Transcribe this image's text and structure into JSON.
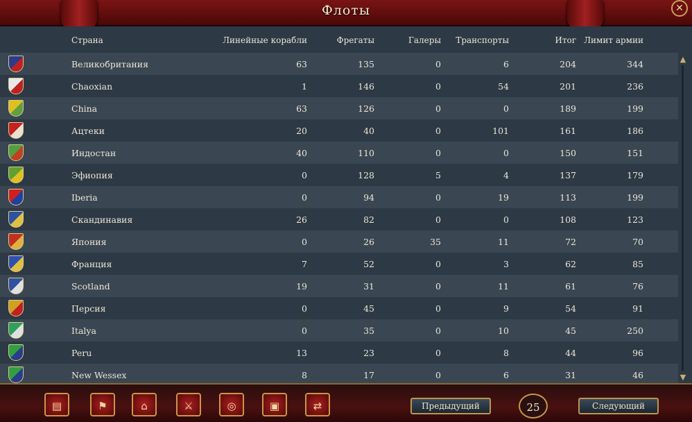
{
  "window": {
    "title": "Флоты",
    "close_icon": "close-icon"
  },
  "columns": {
    "country": "Страна",
    "ships_of_line": "Линейные корабли",
    "frigates": "Фрегаты",
    "galleys": "Галеры",
    "transports": "Транспорты",
    "total": "Итог",
    "limit": "Лимит армии"
  },
  "rows": [
    {
      "name": "Великобритания",
      "a": "63",
      "b": "135",
      "c": "0",
      "d": "6",
      "t": "204",
      "l": "344",
      "flag": "#2a3c8a",
      "flag2": "#c02020"
    },
    {
      "name": "Chaoxian",
      "a": "1",
      "b": "146",
      "c": "0",
      "d": "54",
      "t": "201",
      "l": "236",
      "flag": "#e8e8e8",
      "flag2": "#c02020"
    },
    {
      "name": "China",
      "a": "63",
      "b": "126",
      "c": "0",
      "d": "0",
      "t": "189",
      "l": "199",
      "flag": "#e0c020",
      "flag2": "#60a040"
    },
    {
      "name": "Ацтеки",
      "a": "20",
      "b": "40",
      "c": "0",
      "d": "101",
      "t": "161",
      "l": "186",
      "flag": "#c82020",
      "flag2": "#e8e0d0"
    },
    {
      "name": "Индостан",
      "a": "40",
      "b": "110",
      "c": "0",
      "d": "0",
      "t": "150",
      "l": "151",
      "flag": "#50a040",
      "flag2": "#c04020"
    },
    {
      "name": "Эфиопия",
      "a": "0",
      "b": "128",
      "c": "5",
      "d": "4",
      "t": "137",
      "l": "179",
      "flag": "#60a030",
      "flag2": "#e0c020"
    },
    {
      "name": "Iberia",
      "a": "0",
      "b": "94",
      "c": "0",
      "d": "19",
      "t": "113",
      "l": "199",
      "flag": "#d02020",
      "flag2": "#2040a0"
    },
    {
      "name": "Скандинавия",
      "a": "26",
      "b": "82",
      "c": "0",
      "d": "0",
      "t": "108",
      "l": "123",
      "flag": "#3050a0",
      "flag2": "#e0c040"
    },
    {
      "name": "Япония",
      "a": "0",
      "b": "26",
      "c": "35",
      "d": "11",
      "t": "72",
      "l": "70",
      "flag": "#c03020",
      "flag2": "#e0b040"
    },
    {
      "name": "Франция",
      "a": "7",
      "b": "52",
      "c": "0",
      "d": "3",
      "t": "62",
      "l": "85",
      "flag": "#3050b0",
      "flag2": "#e0c040"
    },
    {
      "name": "Scotland",
      "a": "19",
      "b": "31",
      "c": "0",
      "d": "11",
      "t": "61",
      "l": "76",
      "flag": "#3050a0",
      "flag2": "#e0e0e0"
    },
    {
      "name": "Персия",
      "a": "0",
      "b": "45",
      "c": "0",
      "d": "9",
      "t": "54",
      "l": "91",
      "flag": "#d0a020",
      "flag2": "#c02020"
    },
    {
      "name": "Italya",
      "a": "0",
      "b": "35",
      "c": "0",
      "d": "10",
      "t": "45",
      "l": "250",
      "flag": "#30a060",
      "flag2": "#e0e0e0"
    },
    {
      "name": "Peru",
      "a": "13",
      "b": "23",
      "c": "0",
      "d": "8",
      "t": "44",
      "l": "96",
      "flag": "#30a040",
      "flag2": "#2a3c8a"
    },
    {
      "name": "New Wessex",
      "a": "8",
      "b": "17",
      "c": "0",
      "d": "6",
      "t": "31",
      "l": "46",
      "flag": "#30a040",
      "flag2": "#2a3c8a"
    }
  ],
  "footer": {
    "prev_label": "Предыдущий",
    "next_label": "Следующий",
    "page": "25",
    "buttons": [
      "ledger-icon",
      "flag-icon",
      "buildings-icon",
      "crossed-swords-icon",
      "coins-icon",
      "crate-icon",
      "handshake-icon"
    ]
  }
}
